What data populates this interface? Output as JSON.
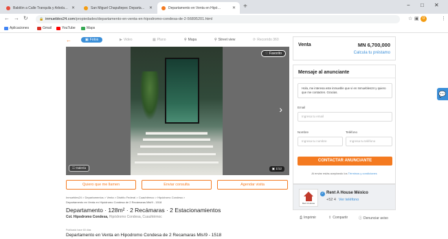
{
  "browser": {
    "tabs": [
      {
        "label": "Babilón a Calle Tranquila y Arbola…",
        "favicon_color": "#e74c3c"
      },
      {
        "label": "San Miguel Chapultepec Departa…",
        "favicon_color": "#f39c12"
      },
      {
        "label": "Departamento en Venta en Hipó…",
        "favicon_color": "#f47a20"
      }
    ],
    "new_tab": "+",
    "window_controls": [
      "−",
      "□",
      "✕"
    ],
    "url_host": "inmuebles24.com",
    "url_path": "/propiedades/departamento-en-venta-en-hipodromo-condesa-de-2-56895201.html",
    "bookmarks": [
      {
        "label": "Aplicaciones",
        "color": "#4285f4"
      },
      {
        "label": "Gmail",
        "color": "#d93025"
      },
      {
        "label": "YouTube",
        "color": "#ff0000"
      },
      {
        "label": "Maps",
        "color": "#34a853"
      }
    ],
    "profile_initial": "0"
  },
  "toolbar": {
    "back": "←",
    "items": [
      "Fotos",
      "Video",
      "Plano",
      "Mapa",
      "Street view",
      "Recorrido 360"
    ]
  },
  "gallery": {
    "favorite": "♡ Favorito",
    "gallery_button": "☷ Galería",
    "counter": "▣ 1/12",
    "next": "›"
  },
  "actions": [
    "Quiero que me llamen",
    "Enviar consulta",
    "Agendar visita"
  ],
  "listing": {
    "breadcrumb": "Inmuebles24 > Departamentos > Venta > Distrito Federal > Cuauhtémoc > Hipódromo Condesa >",
    "breadcrumb2": "Departamento en Venta en Hipódromo Condesa de 2 Recámaras Mls!9 - 1518",
    "headline": "Departamento · 128m² · 2 Recámaras · 2 Estacionamientos",
    "address_strong": "Col. Hipodromo Condesa,",
    "address_rest": " Hipódromo Condesa, Cuauhtémoc",
    "published": "Publicado hace 60 días",
    "description_title": "Departamento en Venta en Hipodromo Condesa de 2 Recamaras Mls!9 - 1518"
  },
  "price": {
    "label": "Venta",
    "value": "MN 6,700,000",
    "loan_link": "Calcula tu préstamo"
  },
  "contact": {
    "title": "Mensaje al anunciante",
    "message": "Hola, me interesa este inmueble que vi en Inmuebles24 y quiero que me contacten. Gracias.",
    "email_label": "Email",
    "email_placeholder": "Ingresa tu email",
    "name_label": "Nombre",
    "name_placeholder": "Ingresa tu nombre",
    "phone_label": "Teléfono",
    "phone_placeholder": "Ingresa tu teléfono",
    "submit": "CONTACTAR ANUNCIANTE",
    "terms_prefix": "Al enviar estás aceptando los ",
    "terms_link": "Términos y condiciones"
  },
  "agent": {
    "name": "Rent A House México",
    "phone": "+52 4",
    "phone_link": "Ver teléfono",
    "logo_text": "Rent A House"
  },
  "share": [
    "Imprimir",
    "Compartir",
    "Denunciar aviso"
  ],
  "colors": {
    "accent": "#f47a20",
    "link": "#3b8fd8"
  }
}
